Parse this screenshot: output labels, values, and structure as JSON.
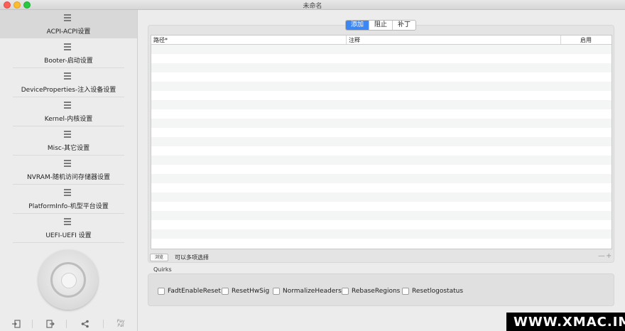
{
  "window": {
    "title": "未命名"
  },
  "sidebar": {
    "items": [
      {
        "label": "ACPI-ACPI设置",
        "icon": "list-icon",
        "active": true
      },
      {
        "label": "Booter-启动设置",
        "icon": "list-icon",
        "active": false
      },
      {
        "label": "DeviceProperties-注入设备设置",
        "icon": "list-icon",
        "active": false
      },
      {
        "label": "Kernel-内核设置",
        "icon": "list-icon",
        "active": false
      },
      {
        "label": "Misc-其它设置",
        "icon": "list-icon",
        "active": false
      },
      {
        "label": "NVRAM-随机访问存储器设置",
        "icon": "list-icon",
        "active": false
      },
      {
        "label": "PlatformInfo-机型平台设置",
        "icon": "list-icon",
        "active": false
      },
      {
        "label": "UEFI-UEFI 设置",
        "icon": "list-icon",
        "active": false
      }
    ],
    "bottom_icons": [
      "import-icon",
      "export-icon",
      "share-icon",
      "paypal-icon"
    ],
    "paypal_text": "Pay Pal"
  },
  "main": {
    "segments": [
      {
        "label": "添加",
        "selected": true
      },
      {
        "label": "阻止",
        "selected": false
      },
      {
        "label": "补丁",
        "selected": false
      }
    ],
    "table": {
      "columns": [
        "路径*",
        "注释",
        "启用"
      ],
      "rows": []
    },
    "browse_button": "浏览",
    "multi_select_text": "可以多项选择",
    "add_remove": "—+",
    "quirks": {
      "label": "Quirks",
      "items": [
        {
          "label": "FadtEnableReset",
          "checked": false
        },
        {
          "label": "ResetHwSig",
          "checked": false
        },
        {
          "label": "NormalizeHeaders",
          "checked": false
        },
        {
          "label": "RebaseRegions",
          "checked": false
        },
        {
          "label": "Resetlogostatus",
          "checked": false
        }
      ]
    }
  },
  "watermark": {
    "text": "WWW.XMAC.IM"
  },
  "colors": {
    "accent": "#3d87f5",
    "sidebar_active": "#d8d8d8"
  }
}
